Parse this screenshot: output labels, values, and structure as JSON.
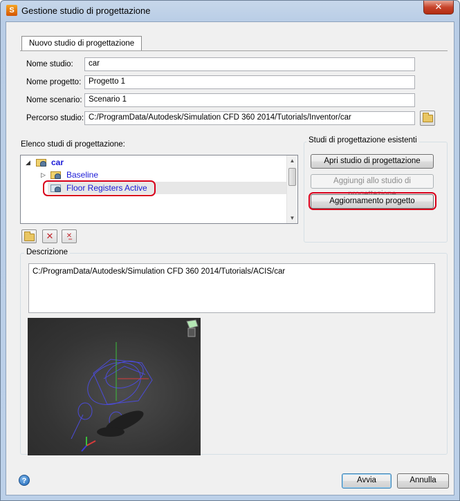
{
  "window": {
    "title": "Gestione studio di progettazione",
    "close_label": "✕"
  },
  "tab": {
    "label": "Nuovo studio di progettazione"
  },
  "form": {
    "study_label": "Nome studio:",
    "study_value": "car",
    "project_label": "Nome progetto:",
    "project_value": "Progetto 1",
    "scenario_label": "Nome scenario:",
    "scenario_value": "Scenario 1",
    "path_label": "Percorso studio:",
    "path_value": "C:/ProgramData/Autodesk/Simulation CFD 360 2014/Tutorials/Inventor/car"
  },
  "tree": {
    "label": "Elenco studi di progettazione:",
    "root": "car",
    "items": [
      "Baseline",
      "Floor Registers Active"
    ]
  },
  "existing": {
    "title": "Studi di progettazione esistenti",
    "open_label": "Apri studio di progettazione",
    "add_label": "Aggiungi allo studio di progettazione",
    "update_label": "Aggiornamento progetto"
  },
  "description": {
    "title": "Descrizione",
    "text": "C:/ProgramData/Autodesk/Simulation CFD 360 2014/Tutorials/ACIS/car"
  },
  "footer": {
    "apply_label": "Avvia",
    "cancel_label": "Annulla",
    "help_symbol": "?"
  },
  "colors": {
    "highlight": "#d9001b",
    "link": "#1a1ad6",
    "accent": "#3c7fb1"
  }
}
